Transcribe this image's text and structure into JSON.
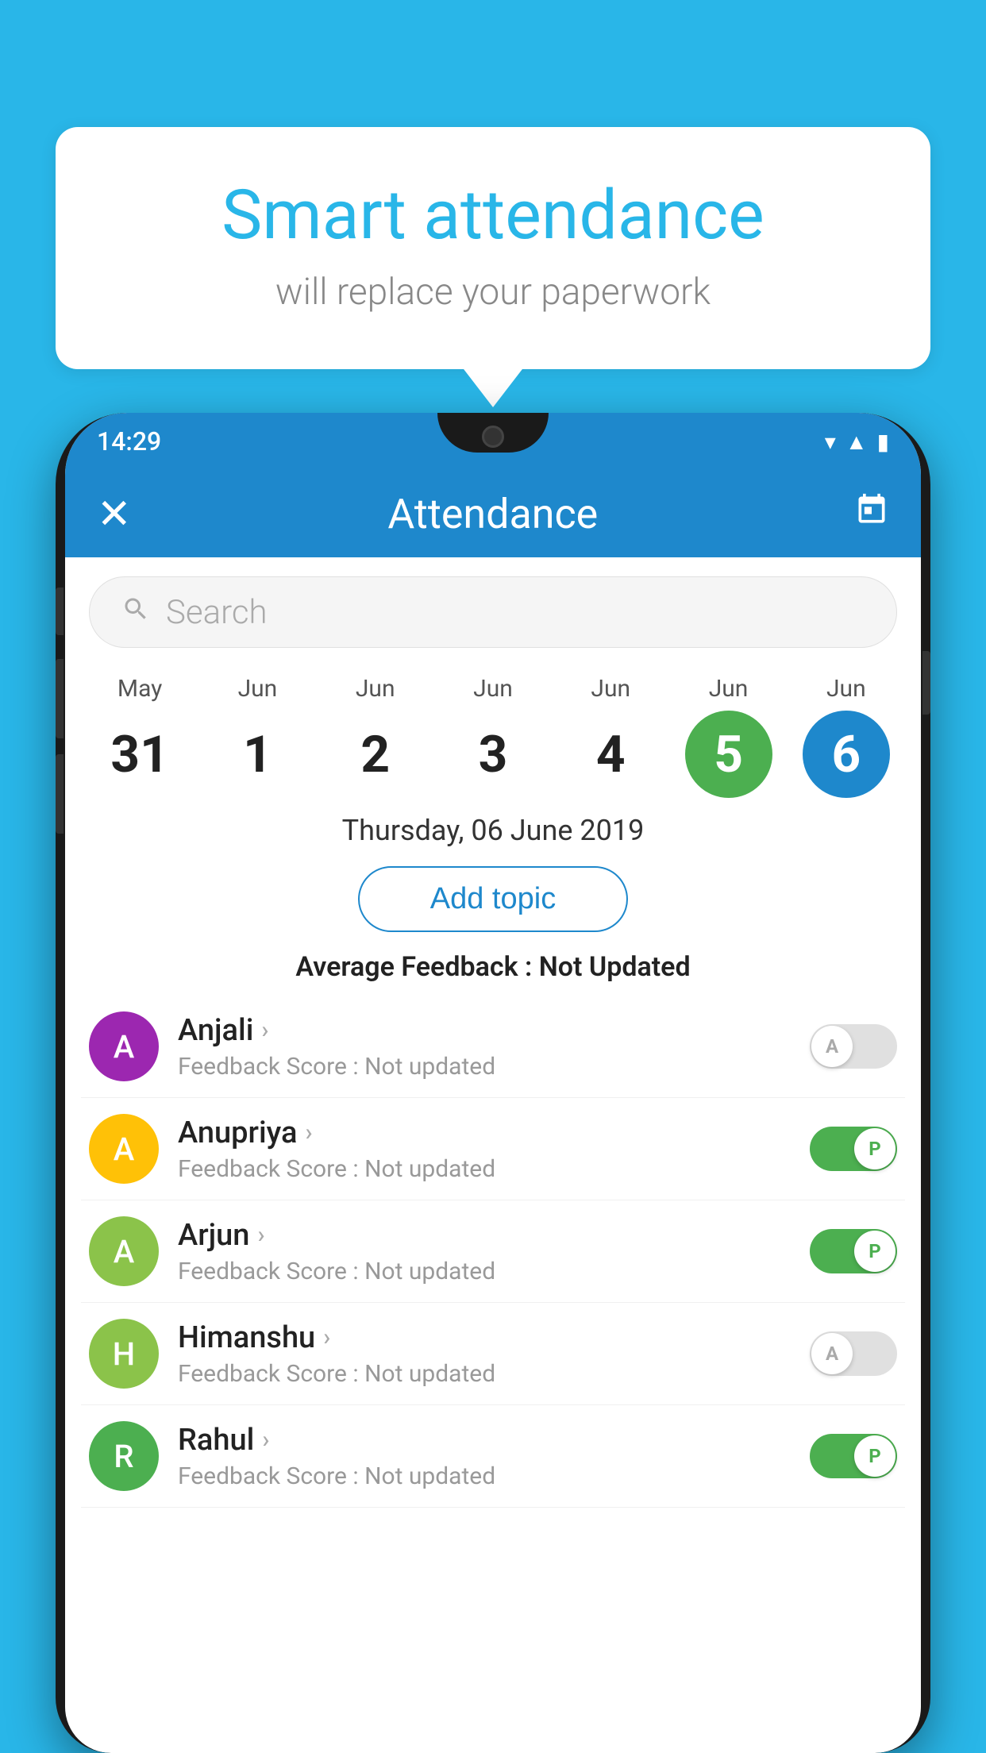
{
  "background_color": "#29b6e8",
  "bubble": {
    "title": "Smart attendance",
    "subtitle": "will replace your paperwork"
  },
  "status_bar": {
    "time": "14:29",
    "icons": [
      "wifi",
      "signal",
      "battery"
    ]
  },
  "app_bar": {
    "title": "Attendance",
    "close_label": "✕",
    "calendar_label": "📅"
  },
  "search": {
    "placeholder": "Search"
  },
  "calendar": {
    "days": [
      {
        "month": "May",
        "date": "31",
        "state": "normal"
      },
      {
        "month": "Jun",
        "date": "1",
        "state": "normal"
      },
      {
        "month": "Jun",
        "date": "2",
        "state": "normal"
      },
      {
        "month": "Jun",
        "date": "3",
        "state": "normal"
      },
      {
        "month": "Jun",
        "date": "4",
        "state": "normal"
      },
      {
        "month": "Jun",
        "date": "5",
        "state": "today"
      },
      {
        "month": "Jun",
        "date": "6",
        "state": "selected"
      }
    ]
  },
  "selected_date_label": "Thursday, 06 June 2019",
  "add_topic_label": "Add topic",
  "avg_feedback_prefix": "Average Feedback : ",
  "avg_feedback_value": "Not Updated",
  "students": [
    {
      "name": "Anjali",
      "initial": "A",
      "avatar_color": "#9c27b0",
      "feedback_prefix": "Feedback Score : ",
      "feedback_value": "Not updated",
      "toggle_state": "off",
      "toggle_label": "A"
    },
    {
      "name": "Anupriya",
      "initial": "A",
      "avatar_color": "#ffc107",
      "feedback_prefix": "Feedback Score : ",
      "feedback_value": "Not updated",
      "toggle_state": "on",
      "toggle_label": "P"
    },
    {
      "name": "Arjun",
      "initial": "A",
      "avatar_color": "#8bc34a",
      "feedback_prefix": "Feedback Score : ",
      "feedback_value": "Not updated",
      "toggle_state": "on",
      "toggle_label": "P"
    },
    {
      "name": "Himanshu",
      "initial": "H",
      "avatar_color": "#8bc34a",
      "feedback_prefix": "Feedback Score : ",
      "feedback_value": "Not updated",
      "toggle_state": "off",
      "toggle_label": "A"
    },
    {
      "name": "Rahul",
      "initial": "R",
      "avatar_color": "#4caf50",
      "feedback_prefix": "Feedback Score : ",
      "feedback_value": "Not updated",
      "toggle_state": "on",
      "toggle_label": "P"
    }
  ]
}
